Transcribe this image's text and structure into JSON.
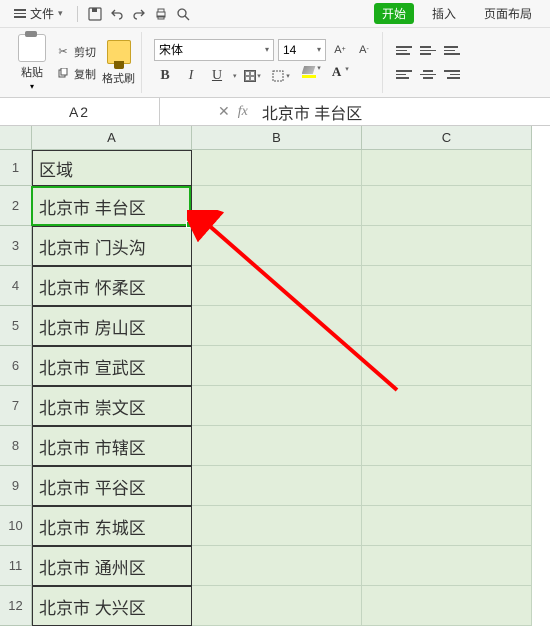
{
  "menubar": {
    "file_label": "文件",
    "tab_start": "开始",
    "tab_insert": "插入",
    "tab_layout": "页面布局"
  },
  "ribbon": {
    "paste_label": "粘贴",
    "cut_label": "剪切",
    "copy_label": "复制",
    "brush_label": "格式刷",
    "font_name": "宋体",
    "font_size": "14",
    "bold": "B",
    "italic": "I",
    "underline": "U",
    "letter_a": "A",
    "fill_color": "#ffff00",
    "font_color": "#c00000"
  },
  "fxbar": {
    "namebox": "A2",
    "fx_label": "fx",
    "formula": "北京市 丰台区"
  },
  "grid": {
    "col_headers": [
      "A",
      "B",
      "C"
    ],
    "rows": [
      {
        "num": "1",
        "A": "区域"
      },
      {
        "num": "2",
        "A": "北京市 丰台区"
      },
      {
        "num": "3",
        "A": "北京市 门头沟"
      },
      {
        "num": "4",
        "A": "北京市 怀柔区"
      },
      {
        "num": "5",
        "A": "北京市 房山区"
      },
      {
        "num": "6",
        "A": "北京市 宣武区"
      },
      {
        "num": "7",
        "A": "北京市 崇文区"
      },
      {
        "num": "8",
        "A": "北京市 市辖区"
      },
      {
        "num": "9",
        "A": "北京市 平谷区"
      },
      {
        "num": "10",
        "A": "北京市 东城区"
      },
      {
        "num": "11",
        "A": "北京市 通州区"
      },
      {
        "num": "12",
        "A": "北京市 大兴区"
      }
    ],
    "active_cell": "A2"
  }
}
